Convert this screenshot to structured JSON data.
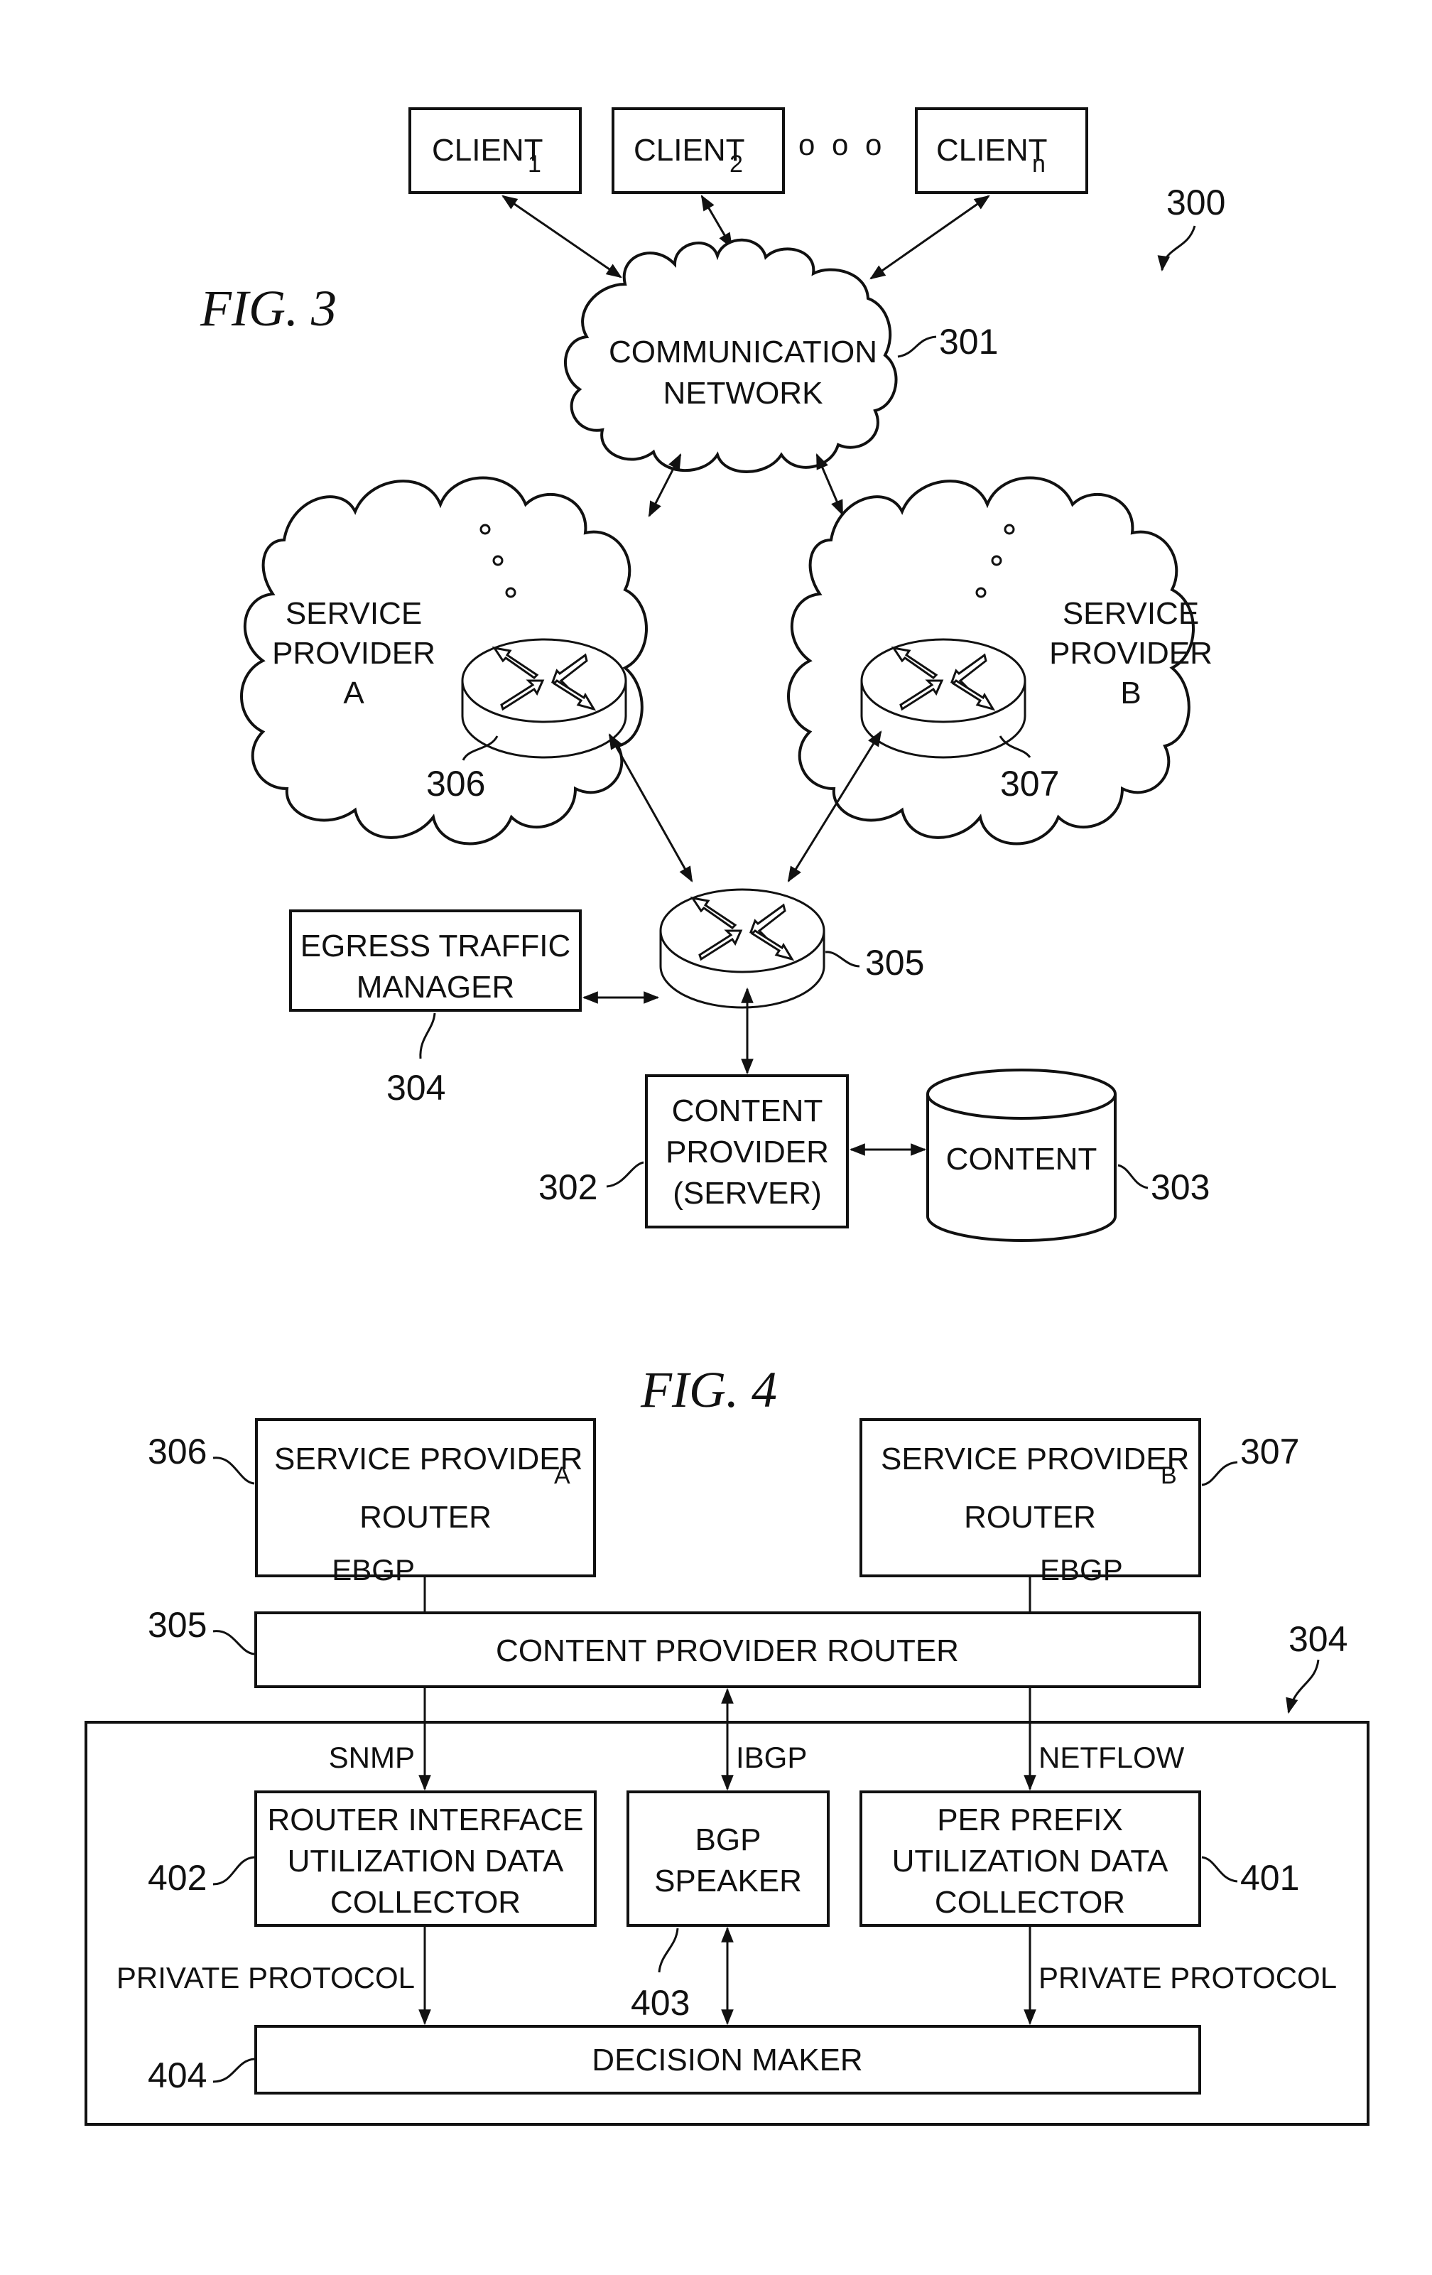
{
  "fig3": {
    "title": "FIG. 3",
    "system_ref": "300",
    "clients": [
      {
        "label": "CLIENT",
        "sub": "1"
      },
      {
        "label": "CLIENT",
        "sub": "2"
      },
      {
        "label": "CLIENT",
        "sub": "n"
      }
    ],
    "ellipsis": "o o o",
    "network": {
      "line1": "COMMUNICATION",
      "line2": "NETWORK",
      "ref": "301"
    },
    "provider_a": {
      "line1": "SERVICE",
      "line2": "PROVIDER",
      "line3": "A",
      "router_ref": "306"
    },
    "provider_b": {
      "line1": "SERVICE",
      "line2": "PROVIDER",
      "line3": "B",
      "router_ref": "307"
    },
    "content_router_ref": "305",
    "egress": {
      "line1": "EGRESS TRAFFIC",
      "line2": "MANAGER",
      "ref": "304"
    },
    "content_provider": {
      "line1": "CONTENT",
      "line2": "PROVIDER",
      "line3": "(SERVER)",
      "ref": "302"
    },
    "content_store": {
      "label": "CONTENT",
      "ref": "303"
    }
  },
  "fig4": {
    "title": "FIG. 4",
    "sp_a": {
      "line1": "SERVICE PROVIDER",
      "sub": "A",
      "line2": "ROUTER",
      "ref": "306"
    },
    "sp_b": {
      "line1": "SERVICE PROVIDER",
      "sub": "B",
      "line2": "ROUTER",
      "ref": "307"
    },
    "ebgp_a": "EBGP",
    "ebgp_b": "EBGP",
    "cp_router": {
      "label": "CONTENT PROVIDER ROUTER",
      "ref": "305"
    },
    "manager_ref": "304",
    "snmp": "SNMP",
    "ibgp": "IBGP",
    "netflow": "NETFLOW",
    "riudc": {
      "line1": "ROUTER INTERFACE",
      "line2": "UTILIZATION DATA",
      "line3": "COLLECTOR",
      "ref": "402"
    },
    "bgp": {
      "line1": "BGP",
      "line2": "SPEAKER",
      "ref": "403"
    },
    "ppudc": {
      "line1": "PER PREFIX",
      "line2": "UTILIZATION DATA",
      "line3": "COLLECTOR",
      "ref": "401"
    },
    "private_left": "PRIVATE PROTOCOL",
    "private_right": "PRIVATE PROTOCOL",
    "decision": {
      "label": "DECISION MAKER",
      "ref": "404"
    }
  }
}
